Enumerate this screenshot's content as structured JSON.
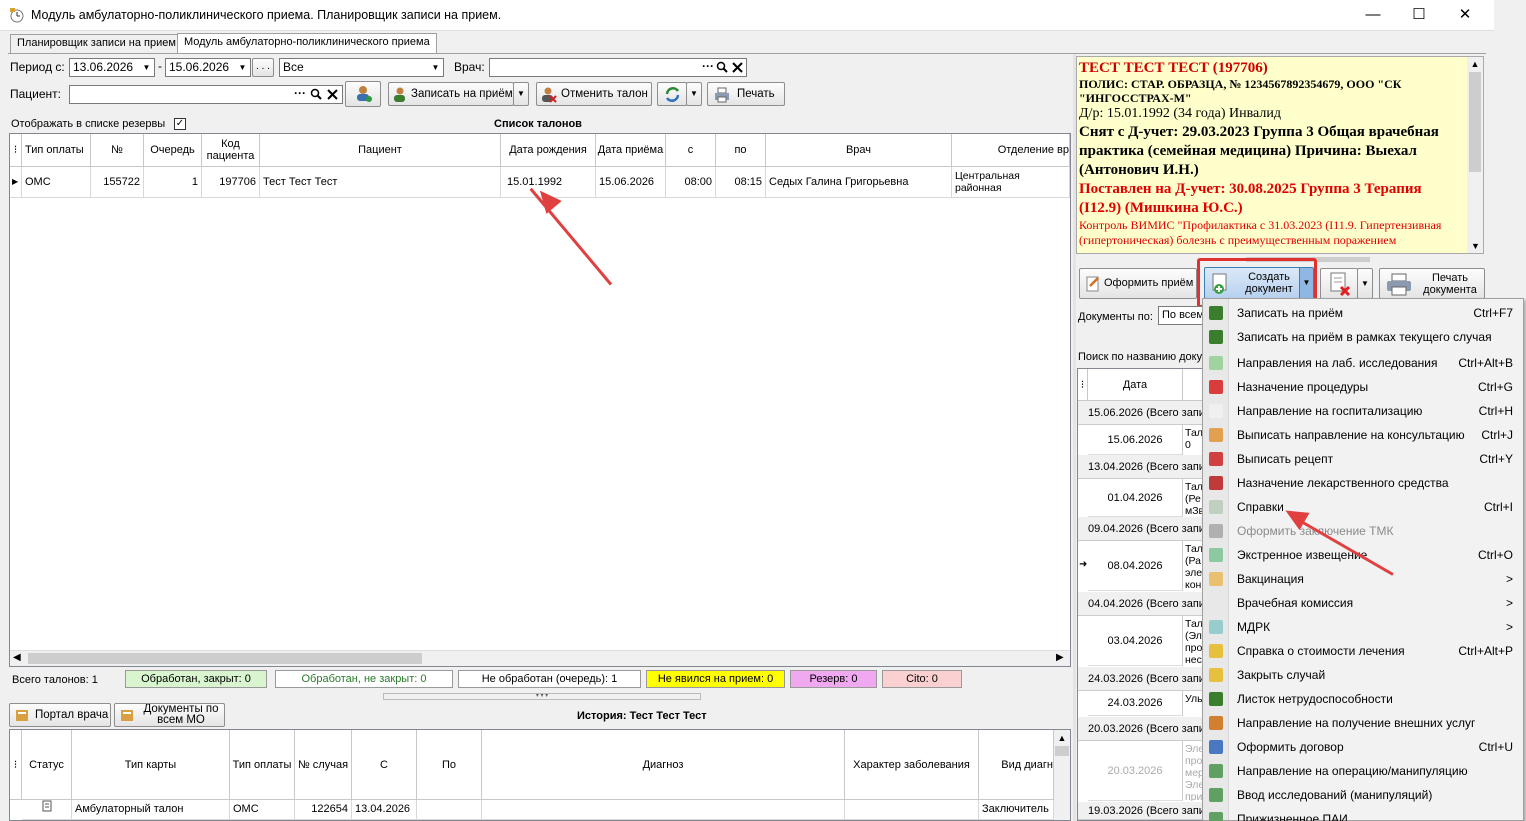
{
  "window": {
    "title": "Модуль амбулаторно-поликлинического приема. Планировщик записи на прием.",
    "minimize": "—",
    "maximize": "☐",
    "close": "✕"
  },
  "tabs": [
    {
      "label": "Планировщик записи на прием"
    },
    {
      "label": "Модуль амбулаторно-поликлинического приема"
    }
  ],
  "filters": {
    "period_label": "Период с:",
    "date_from": "13.06.2026",
    "dash": "-",
    "date_to": "15.06.2026",
    "dots": ". . .",
    "status_value": "Все",
    "doctor_label": "Врач:",
    "doctor_value": "",
    "patient_label": "Пациент:",
    "patient_value": "",
    "ellipsis": "···"
  },
  "toolbar": {
    "book": "Записать на приём",
    "cancel": "Отменить талон",
    "print": "Печать"
  },
  "reserve_label": "Отображать в списке резервы",
  "list_title": "Список талонов",
  "talon_columns": [
    "Тип оплаты",
    "№",
    "Очередь",
    "Код пациента",
    "Пациент",
    "Дата рождения",
    "Дата приёма",
    "с",
    "по",
    "Врач",
    "Отделение вр"
  ],
  "talon_rows": [
    {
      "pay": "ОМС",
      "num": "155722",
      "queue": "1",
      "code": "197706",
      "patient": "Тест Тест Тест",
      "dob": "15.01.1992",
      "date": "15.06.2026",
      "from": "08:00",
      "to": "08:15",
      "doctor": "Седых Галина Григорьевна",
      "dept": "Центральная районная поликлиника"
    }
  ],
  "status_bar": {
    "total": "Всего талонов: 1",
    "closed": "Обработан, закрыт: 0",
    "not_closed": "Обработан, не закрыт: 0",
    "queue": "Не обработан (очередь): 1",
    "no_show": "Не явился на прием: 0",
    "reserve": "Резерв: 0",
    "cito": "Cito: 0"
  },
  "history": {
    "portal": "Портал врача",
    "docs": "Документы по всем МО",
    "title": "История: Тест Тест Тест",
    "columns": [
      "Статус",
      "Тип карты",
      "Тип оплаты",
      "№ случая",
      "С",
      "По",
      "Диагноз",
      "Характер заболевания",
      "Вид диагн"
    ],
    "row": {
      "type": "Амбулаторный талон",
      "pay": "ОМС",
      "num": "122654",
      "from": "13.04.2026",
      "to": "",
      "diag": "",
      "char": "",
      "kind": "Заключитель"
    }
  },
  "patient_info": {
    "name": "ТЕСТ ТЕСТ ТЕСТ (197706)",
    "policy": "ПОЛИС: СТАР. ОБРАЗЦА, № 1234567892354679, ООО \"СК \"ИНГОССТРАХ-М\"",
    "dob": "Д/р: 15.01.1992 (34 года) Инвалид",
    "removed": "Снят с Д-учет: 29.03.2023 Группа 3 Общая врачебная практика (семейная медицина) Причина: Выехал (Антонович И.Н.)",
    "added": "Поставлен на Д-учет: 30.08.2025 Группа 3 Терапия (I12.9) (Мишкина Ю.С.)",
    "control": "Контроль ВИМИС \"Профилактика с 31.03.2023 (I11.9. Гипертензивная (гипертоническая) болезнь с преимущественным поражением"
  },
  "right_buttons": {
    "admit": "Оформить приём",
    "create_line1": "Создать",
    "create_line2": "документ",
    "print_line1": "Печать",
    "print_line2": "документа"
  },
  "docs_by_label": "Документы по:",
  "docs_by_value": "По всем",
  "search_doc_label": "Поиск по названию доку",
  "doc_date_header": "Дата",
  "doc_groups": [
    {
      "label": "15.06.2026  (Всего запи",
      "date": "15.06.2026",
      "desc": "Тал 0"
    },
    {
      "label": "13.04.2026  (Всего запи",
      "date": "01.04.2026",
      "desc": "Тал (Ре мЗв"
    },
    {
      "label": "09.04.2026  (Всего запи",
      "date": "08.04.2026",
      "desc": "Тал (Ра эле кон"
    },
    {
      "label": "04.04.2026  (Всего запи",
      "date": "03.04.2026",
      "desc": "Тал (Эл про нес"
    },
    {
      "label": "24.03.2026  (Всего запи",
      "date": "24.03.2026",
      "desc": "Уль"
    },
    {
      "label": "20.03.2026  (Всего запи",
      "date": "20.03.2026",
      "desc": "Эле про мер Эле при"
    },
    {
      "label": "19.03.2026  (Всего запи",
      "date": "",
      "desc": ""
    }
  ],
  "menu": [
    {
      "label": "Записать на приём",
      "shortcut": "Ctrl+F7",
      "icon": "user-add-icon",
      "color": "#3a7d2c",
      "disabled": false
    },
    {
      "label": "Записать на приём в рамках текущего случая",
      "shortcut": "",
      "icon": "user-add-icon",
      "color": "#3a7d2c",
      "disabled": false
    },
    {
      "label": "Направления на лаб. исследования",
      "shortcut": "Ctrl+Alt+B",
      "icon": "flask-icon",
      "color": "#9fd4a0",
      "disabled": false
    },
    {
      "label": "Назначение процедуры",
      "shortcut": "Ctrl+G",
      "icon": "procedure-icon",
      "color": "#d83c3c",
      "disabled": false
    },
    {
      "label": "Направление на госпитализацию",
      "shortcut": "Ctrl+H",
      "icon": "hospital-icon",
      "color": "#f0f0f0",
      "disabled": false
    },
    {
      "label": "Выписать направление на консультацию",
      "shortcut": "Ctrl+J",
      "icon": "doctors-icon",
      "color": "#e0a050",
      "disabled": false
    },
    {
      "label": "Выписать рецепт",
      "shortcut": "Ctrl+Y",
      "icon": "pill-icon",
      "color": "#d04040",
      "disabled": false
    },
    {
      "label": "Назначение лекарственного средства",
      "shortcut": "",
      "icon": "pill-icon",
      "color": "#c03a3a",
      "disabled": false
    },
    {
      "label": "Справки",
      "shortcut": "Ctrl+I",
      "icon": "certificate-icon",
      "color": "#c0d0c0",
      "disabled": false
    },
    {
      "label": "Оформить заключение ТМК",
      "shortcut": "",
      "icon": "tmk-icon",
      "color": "#b0b0b0",
      "disabled": true
    },
    {
      "label": "Экстренное извещение",
      "shortcut": "Ctrl+O",
      "icon": "key-icon",
      "color": "#8cc8a0",
      "disabled": false
    },
    {
      "label": "Вакцинация",
      "shortcut": ">",
      "icon": "syringe-icon",
      "color": "#e8c070",
      "disabled": false
    },
    {
      "label": "Врачебная комиссия",
      "shortcut": ">",
      "icon": "",
      "color": "",
      "disabled": false
    },
    {
      "label": "МДРК",
      "shortcut": ">",
      "icon": "mdrk-icon",
      "color": "#9cc",
      "disabled": false
    },
    {
      "label": "Справка о стоимости лечения",
      "shortcut": "Ctrl+Alt+P",
      "icon": "cost-icon",
      "color": "#e8c040",
      "disabled": false
    },
    {
      "label": "Закрыть случай",
      "shortcut": "",
      "icon": "close-case-icon",
      "color": "#e8c040",
      "disabled": false
    },
    {
      "label": "Листок нетрудоспособности",
      "shortcut": "",
      "icon": "sick-leave-icon",
      "color": "#3a7d2c",
      "disabled": false
    },
    {
      "label": "Направление на получение внешних услуг",
      "shortcut": "",
      "icon": "external-services-icon",
      "color": "#d08030",
      "disabled": false
    },
    {
      "label": "Оформить договор",
      "shortcut": "Ctrl+U",
      "icon": "contract-icon",
      "color": "#4a78c0",
      "disabled": false
    },
    {
      "label": "Направление на операцию/манипуляцию",
      "shortcut": "",
      "icon": "operation-icon",
      "color": "#60a060",
      "disabled": false
    },
    {
      "label": "Ввод исследований (манипуляций)",
      "shortcut": "",
      "icon": "research-icon",
      "color": "#60a060",
      "disabled": false
    },
    {
      "label": "Прижизненное ПАИ",
      "shortcut": "",
      "icon": "pai-icon",
      "color": "#60a060",
      "disabled": false
    }
  ]
}
